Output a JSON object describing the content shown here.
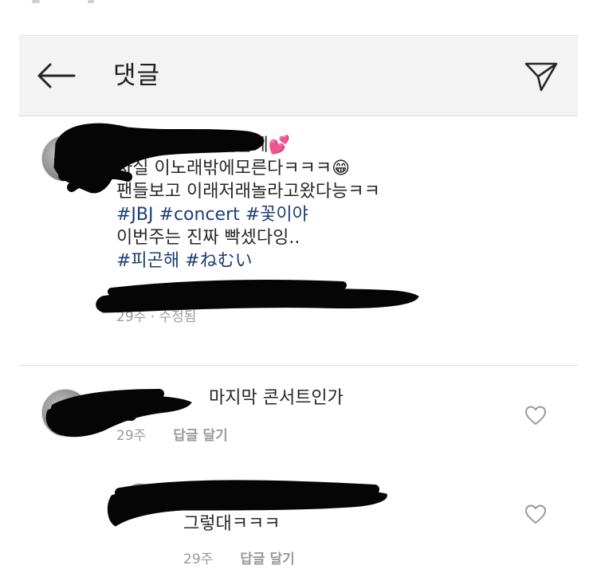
{
  "header": {
    "title": "댓글",
    "back_icon": "arrow-left-icon",
    "send_icon": "paper-plane-icon"
  },
  "caption": {
    "lines": [
      "덕분에💕",
      "사실 이노래밖에모른다ㅋㅋㅋ😁",
      "팬들보고 이래저래놀라고왔다능ㅋㅋ"
    ],
    "hashtags_line1": [
      "#JBJ",
      "#concert",
      "#꽃이야"
    ],
    "line4": "이번주는 진짜 빡셌다잉..",
    "hashtags_line2": [
      "#피곤해",
      "#ねむい"
    ],
    "time": "29주",
    "edited": "수정됨"
  },
  "comments": [
    {
      "text": "마지막 콘서트인가",
      "time": "29주",
      "reply_label": "답글 달기"
    },
    {
      "text": "그렇대ㅋㅋㅋ",
      "time": "29주",
      "reply_label": "답글 달기"
    }
  ]
}
